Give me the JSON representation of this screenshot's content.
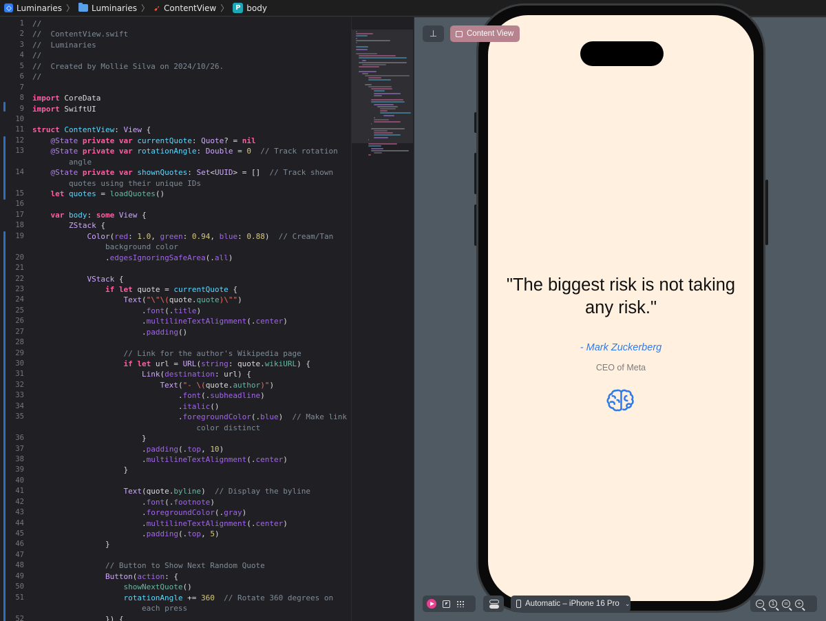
{
  "breadcrumb": {
    "project": "Luminaries",
    "folder": "Luminaries",
    "file": "ContentView",
    "symbol": "body",
    "symbol_badge": "P"
  },
  "editor": {
    "lines": [
      {
        "n": "1",
        "html": "<span class='c'>//</span>"
      },
      {
        "n": "2",
        "html": "<span class='c'>//  ContentView.swift</span>"
      },
      {
        "n": "3",
        "html": "<span class='c'>//  Luminaries</span>"
      },
      {
        "n": "4",
        "html": "<span class='c'>//</span>"
      },
      {
        "n": "5",
        "html": "<span class='c'>//  Created by Mollie Silva on 2024/10/26.</span>"
      },
      {
        "n": "6",
        "html": "<span class='c'>//</span>"
      },
      {
        "n": "7",
        "html": ""
      },
      {
        "n": "8",
        "html": "<span class='k'>import</span> CoreData"
      },
      {
        "n": "9",
        "html": "<span class='k'>import</span> SwiftUI"
      },
      {
        "n": "10",
        "html": ""
      },
      {
        "n": "11",
        "html": "<span class='k'>struct</span> <span class='t'>ContentView</span>: <span class='tp'>View</span> {"
      },
      {
        "n": "12",
        "html": "    <span class='a'>@State</span> <span class='k'>private</span> <span class='k'>var</span> <span class='t'>currentQuote</span>: <span class='tp'>Quote</span>? = <span class='k'>nil</span>"
      },
      {
        "n": "13",
        "html": "    <span class='a'>@State</span> <span class='k'>private</span> <span class='k'>var</span> <span class='t'>rotationAngle</span>: <span class='tp'>Double</span> = <span class='n'>0</span>  <span class='c'>// Track rotation</span>"
      },
      {
        "n": "",
        "html": "        <span class='c'>angle</span>"
      },
      {
        "n": "14",
        "html": "    <span class='a'>@State</span> <span class='k'>private</span> <span class='k'>var</span> <span class='t'>shownQuotes</span>: <span class='tp'>Set</span>&lt;<span class='tp'>UUID</span>&gt; = []  <span class='c'>// Track shown</span>"
      },
      {
        "n": "",
        "html": "        <span class='c'>quotes using their unique IDs</span>"
      },
      {
        "n": "15",
        "html": "    <span class='k'>let</span> <span class='t'>quotes</span> = <span class='f'>loadQuotes</span>()"
      },
      {
        "n": "16",
        "html": ""
      },
      {
        "n": "17",
        "html": "    <span class='k'>var</span> <span class='t'>body</span>: <span class='k'>some</span> <span class='tp'>View</span> {"
      },
      {
        "n": "18",
        "html": "        <span class='tp'>ZStack</span> {"
      },
      {
        "n": "19",
        "html": "            <span class='tp'>Color</span>(<span class='m'>red</span>: <span class='n'>1.0</span>, <span class='m'>green</span>: <span class='n'>0.94</span>, <span class='m'>blue</span>: <span class='n'>0.88</span>)  <span class='c'>// Cream/Tan</span>"
      },
      {
        "n": "",
        "html": "                <span class='c'>background color</span>"
      },
      {
        "n": "20",
        "html": "                .<span class='m'>edgesIgnoringSafeArea</span>(.<span class='m'>all</span>)"
      },
      {
        "n": "21",
        "html": ""
      },
      {
        "n": "22",
        "html": "            <span class='tp'>VStack</span> {"
      },
      {
        "n": "23",
        "html": "                <span class='k'>if</span> <span class='k'>let</span> quote = <span class='t'>currentQuote</span> {"
      },
      {
        "n": "24",
        "html": "                    <span class='tp'>Text</span>(<span class='s'>\"\\\"\\(</span>quote.<span class='f'>quote</span><span class='s'>)\\\"\"</span>)"
      },
      {
        "n": "25",
        "html": "                        .<span class='m'>font</span>(.<span class='m'>title</span>)"
      },
      {
        "n": "26",
        "html": "                        .<span class='m'>multilineTextAlignment</span>(.<span class='m'>center</span>)"
      },
      {
        "n": "27",
        "html": "                        .<span class='m'>padding</span>()"
      },
      {
        "n": "28",
        "html": ""
      },
      {
        "n": "29",
        "html": "                    <span class='c'>// Link for the author's Wikipedia page</span>"
      },
      {
        "n": "30",
        "html": "                    <span class='k'>if</span> <span class='k'>let</span> url = <span class='tp'>URL</span>(<span class='m'>string</span>: quote.<span class='f'>wikiURL</span>) {"
      },
      {
        "n": "31",
        "html": "                        <span class='tp'>Link</span>(<span class='m'>destination</span>: url) {"
      },
      {
        "n": "32",
        "html": "                            <span class='tp'>Text</span>(<span class='s'>\"- \\(</span>quote.<span class='f'>author</span><span class='s'>)\"</span>)"
      },
      {
        "n": "33",
        "html": "                                .<span class='m'>font</span>(.<span class='m'>subheadline</span>)"
      },
      {
        "n": "34",
        "html": "                                .<span class='m'>italic</span>()"
      },
      {
        "n": "35",
        "html": "                                .<span class='m'>foregroundColor</span>(.<span class='m'>blue</span>)  <span class='c'>// Make link</span>"
      },
      {
        "n": "",
        "html": "                                    <span class='c'>color distinct</span>"
      },
      {
        "n": "36",
        "html": "                        }"
      },
      {
        "n": "37",
        "html": "                        .<span class='m'>padding</span>(.<span class='m'>top</span>, <span class='n'>10</span>)"
      },
      {
        "n": "38",
        "html": "                        .<span class='m'>multilineTextAlignment</span>(.<span class='m'>center</span>)"
      },
      {
        "n": "39",
        "html": "                    }"
      },
      {
        "n": "40",
        "html": ""
      },
      {
        "n": "41",
        "html": "                    <span class='tp'>Text</span>(quote.<span class='f'>byline</span>)  <span class='c'>// Display the byline</span>"
      },
      {
        "n": "42",
        "html": "                        .<span class='m'>font</span>(.<span class='m'>footnote</span>)"
      },
      {
        "n": "43",
        "html": "                        .<span class='m'>foregroundColor</span>(.<span class='m'>gray</span>)"
      },
      {
        "n": "44",
        "html": "                        .<span class='m'>multilineTextAlignment</span>(.<span class='m'>center</span>)"
      },
      {
        "n": "45",
        "html": "                        .<span class='m'>padding</span>(.<span class='m'>top</span>, <span class='n'>5</span>)"
      },
      {
        "n": "46",
        "html": "                }"
      },
      {
        "n": "47",
        "html": ""
      },
      {
        "n": "48",
        "html": "                <span class='c'>// Button to Show Next Random Quote</span>"
      },
      {
        "n": "49",
        "html": "                <span class='tp'>Button</span>(<span class='m'>action</span>: {"
      },
      {
        "n": "50",
        "html": "                    <span class='f'>showNextQuote</span>()"
      },
      {
        "n": "51",
        "html": "                    <span class='t'>rotationAngle</span> += <span class='n'>360</span>  <span class='c'>// Rotate 360 degrees on</span>"
      },
      {
        "n": "",
        "html": "                        <span class='c'>each press</span>"
      },
      {
        "n": "52",
        "html": "                }) {"
      }
    ]
  },
  "preview": {
    "content_view_label": "Content View",
    "quote_text": "\"The biggest risk is not taking any risk.\"",
    "author": "- Mark Zuckerberg",
    "byline": "CEO of Meta",
    "device_label": "Automatic – iPhone 16 Pro",
    "screen_color": "#fff0e0",
    "author_color": "#2f7bea"
  },
  "colors": {
    "editor_bg": "#1f1f24",
    "preview_bg": "#505a63",
    "content_view_btn": "#b7838e",
    "play_icon": "#e83f8f"
  }
}
